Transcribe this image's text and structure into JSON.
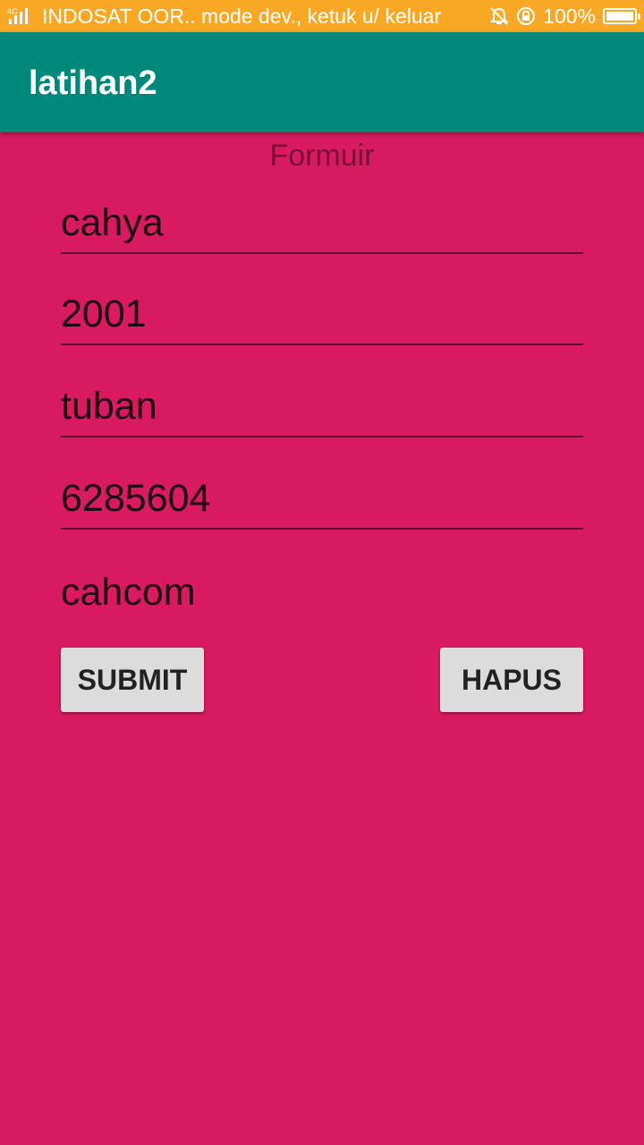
{
  "status_bar": {
    "network_type": "4G",
    "carrier_text": "INDOSAT OOR.. mode dev., ketuk u/ keluar",
    "battery_percent": "100%",
    "battery_level": 1.0,
    "icons": [
      "signal-icon",
      "mute-icon",
      "rotation-lock-icon",
      "battery-icon"
    ]
  },
  "app_bar": {
    "title": "latihan2"
  },
  "form": {
    "heading": "Formuir",
    "fields": [
      {
        "value": "cahya"
      },
      {
        "value": "2001"
      },
      {
        "value": "tuban"
      },
      {
        "value": "6285604"
      },
      {
        "value": "cahcom"
      }
    ],
    "submit_label": "SUBMIT",
    "clear_label": "HAPUS"
  },
  "colors": {
    "status_bar": "#f9a825",
    "app_bar": "#00897b",
    "background": "#d81b60",
    "button": "#dcdcdc"
  }
}
